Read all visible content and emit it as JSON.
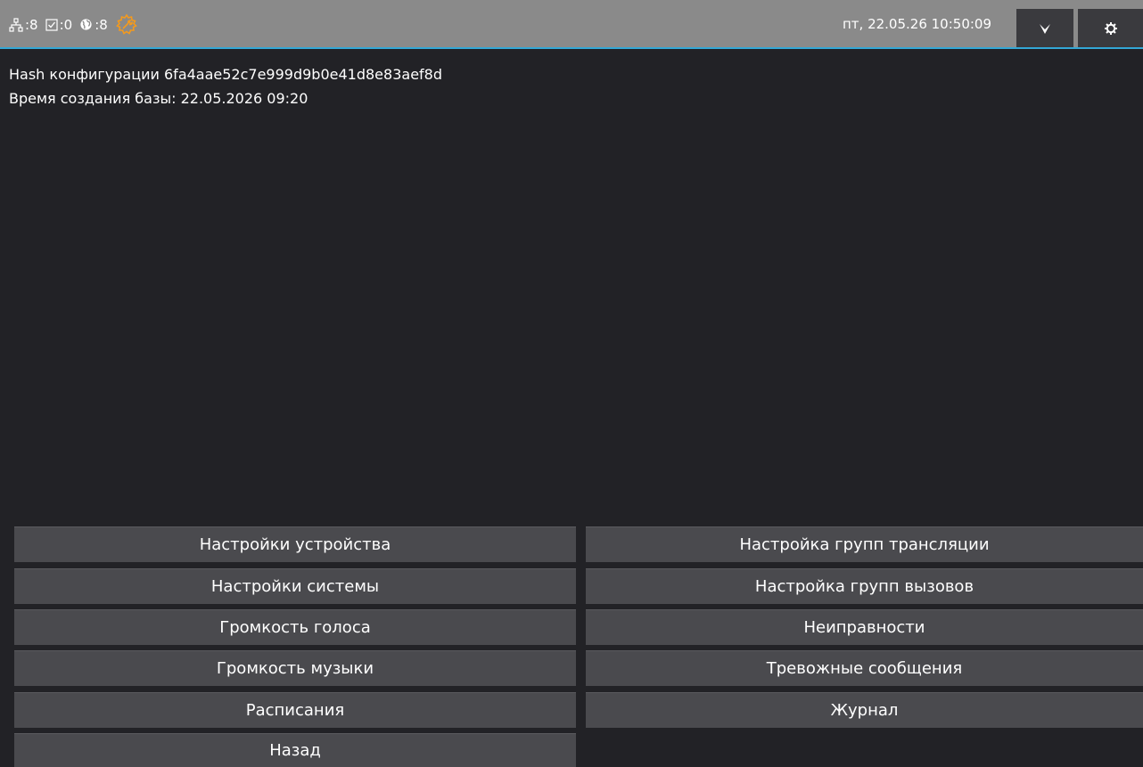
{
  "status": {
    "network_count": ":8",
    "checked_count": ":0",
    "global_count": ":8",
    "gear_color": "#f39a1e"
  },
  "header": {
    "datetime": "пт, 22.05.26 10:50:09"
  },
  "info": {
    "hash_line": "Hash конфигурации 6fa4aae52c7e999d9b0e41d8e83aef8d",
    "db_line": "Время создания базы:  22.05.2026 09:20"
  },
  "menu": {
    "device_settings": "Настройки устройства",
    "broadcast_groups": "Настройка групп трансляции",
    "system_settings": "Настройки системы",
    "call_groups": "Настройка групп вызовов",
    "voice_volume": "Громкость голоса",
    "faults": "Неиправности",
    "music_volume": "Громкость музыки",
    "alarm_messages": "Тревожные сообщения",
    "schedules": "Расписания",
    "journal": "Журнал",
    "back": "Назад"
  },
  "colors": {
    "accent": "#33a7d6",
    "topbar": "#8a8a8a",
    "background": "#222226",
    "button": "#4a4a4e"
  }
}
